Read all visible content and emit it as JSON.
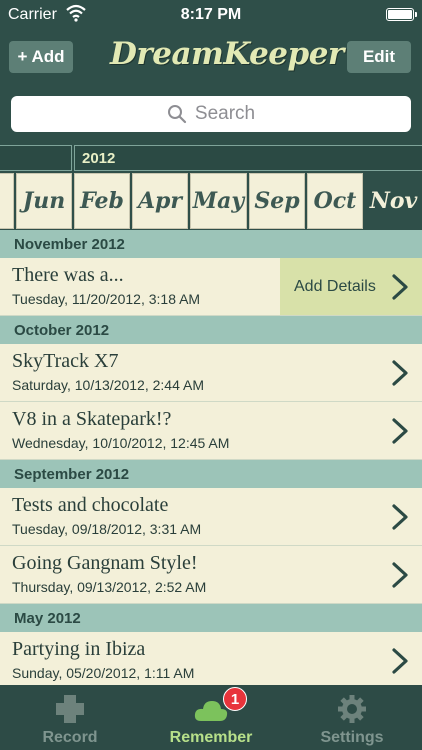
{
  "status_bar": {
    "carrier": "Carrier",
    "time": "8:17 PM"
  },
  "nav": {
    "add_label": "+ Add",
    "logo": "DreamKeeper",
    "edit_label": "Edit"
  },
  "search": {
    "placeholder": "Search"
  },
  "timeline": {
    "years": [
      "",
      "2012"
    ],
    "months": [
      "y",
      "Jun",
      "Feb",
      "Apr",
      "May",
      "Sep",
      "Oct",
      "Nov"
    ],
    "selected_month": "Nov"
  },
  "sections": [
    {
      "header": "November 2012",
      "rows": [
        {
          "title": "There was a...",
          "date": "Tuesday, 11/20/2012, 3:18 AM",
          "action": "Add Details"
        }
      ]
    },
    {
      "header": "October 2012",
      "rows": [
        {
          "title": "SkyTrack X7",
          "date": "Saturday, 10/13/2012, 2:44 AM"
        },
        {
          "title": "V8 in a Skatepark!?",
          "date": "Wednesday, 10/10/2012, 12:45 AM"
        }
      ]
    },
    {
      "header": "September 2012",
      "rows": [
        {
          "title": "Tests and chocolate",
          "date": "Tuesday, 09/18/2012, 3:31 AM"
        },
        {
          "title": "Going Gangnam Style!",
          "date": "Thursday, 09/13/2012, 2:52 AM"
        }
      ]
    },
    {
      "header": "May 2012",
      "rows": [
        {
          "title": "Partying in Ibiza",
          "date": "Sunday, 05/20/2012, 1:11 AM"
        }
      ]
    }
  ],
  "tabs": [
    {
      "label": "Record",
      "icon": "plus-cross-icon"
    },
    {
      "label": "Remember",
      "icon": "cloud-icon",
      "badge": "1"
    },
    {
      "label": "Settings",
      "icon": "gear-icon"
    }
  ],
  "colors": {
    "header": "#2f4f49",
    "section": "#9cc4b8",
    "row": "#f3f0d9",
    "accent": "#b7e08a",
    "badge": "#e8343b"
  }
}
